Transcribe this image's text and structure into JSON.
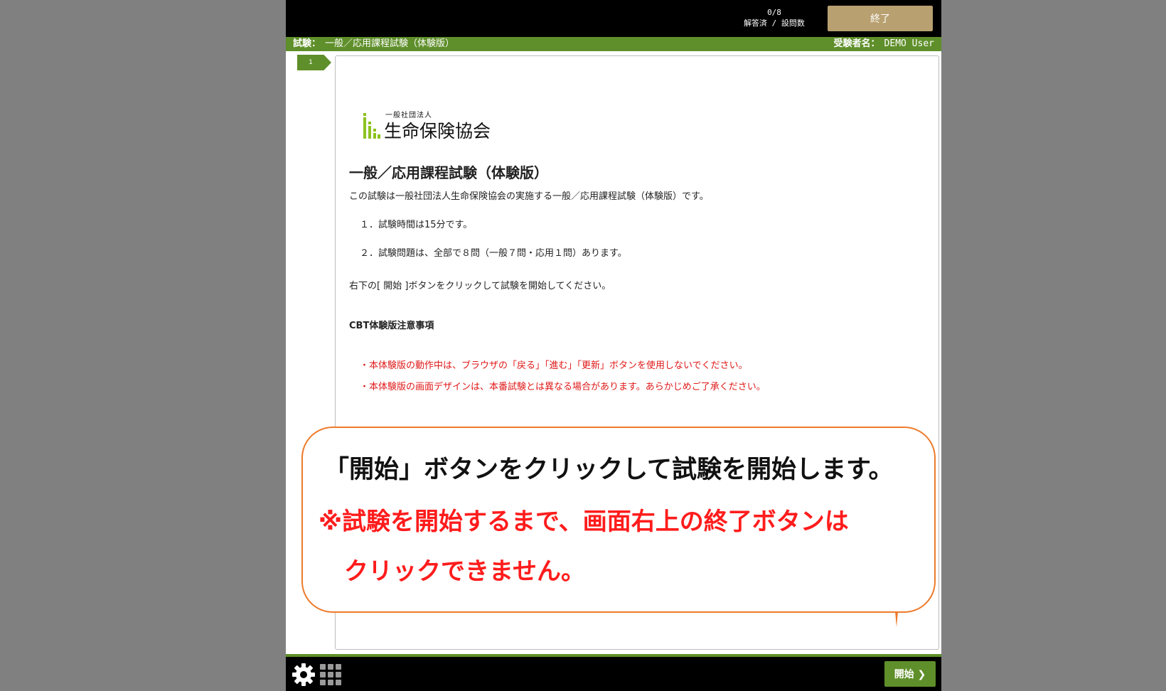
{
  "header": {
    "progress_count": "0/8",
    "progress_label": "解答済 / 設問数",
    "end_button": "終了"
  },
  "infobar": {
    "exam_label": "試験：",
    "exam_name": "一般／応用課程試験（体験版）",
    "examinee_label": "受験者名：",
    "examinee_name": "DEMO User"
  },
  "page_tab": "1",
  "logo": {
    "small": "一般社団法人",
    "big": "生命保険協会",
    "color": "#8dc21f"
  },
  "content": {
    "title": "一般／応用課程試験（体験版）",
    "intro": "この試験は一般社団法人生命保険協会の実施する一般／応用課程試験（体験版）です。",
    "item1": "１．試験時間は15分です。",
    "item2": "２．試験問題は、全部で８問（一般７問・応用１問）あります。",
    "instruction": "右下の[ 開始 ]ボタンをクリックして試験を開始してください。",
    "notice_title": "CBT体験版注意事項",
    "notice1": "・本体験版の動作中は、ブラウザの「戻る」「進む」「更新」ボタンを使用しないでください。",
    "notice2": "・本体験版の画面デザインは、本番試験とは異なる場合があります。あらかじめご了承ください。"
  },
  "callout": {
    "line1": "「開始」ボタンをクリックして試験を開始します。",
    "line2": "※試験を開始するまで、画面右上の終了ボタンは",
    "line3": "クリックできません。",
    "border_color": "#ee7a2a"
  },
  "footer": {
    "start_button": "開始 ❯",
    "settings_icon": "gear-icon",
    "menu_icon": "grid-icon"
  }
}
